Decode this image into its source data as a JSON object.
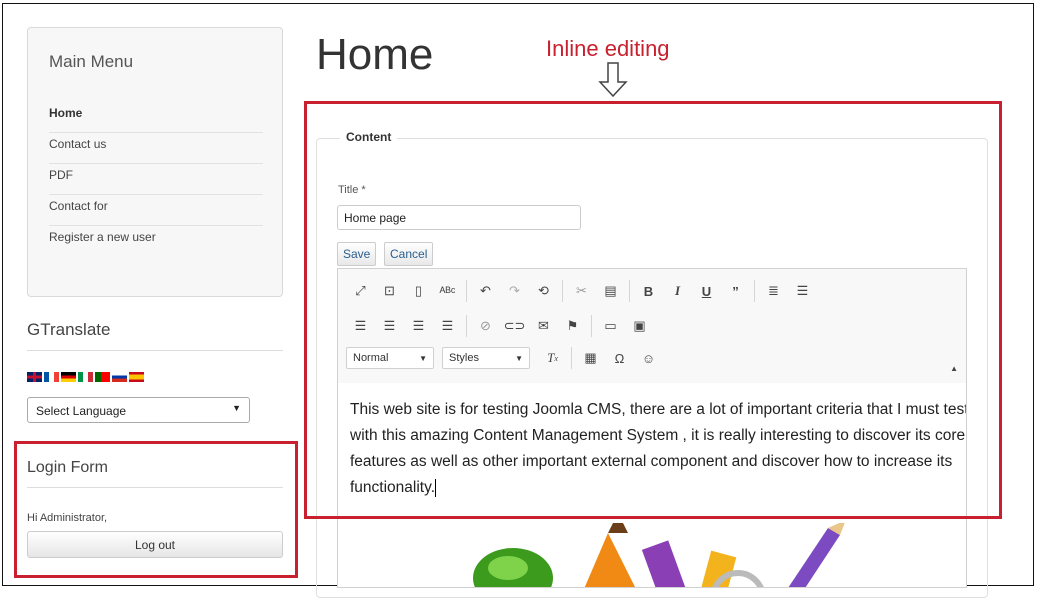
{
  "sidebar": {
    "main_menu": {
      "title": "Main Menu",
      "items": [
        {
          "label": "Home"
        },
        {
          "label": "Contact us"
        },
        {
          "label": "PDF"
        },
        {
          "label": "Contact for"
        },
        {
          "label": "Register a new user"
        }
      ]
    },
    "gtranslate": {
      "title": "GTranslate",
      "flags": [
        "uk-flag-icon",
        "fr-flag-icon",
        "de-flag-icon",
        "it-flag-icon",
        "pt-flag-icon",
        "ru-flag-icon",
        "es-flag-icon"
      ],
      "select_value": "Select Language"
    },
    "login": {
      "title": "Login Form",
      "greeting": "Hi Administrator,",
      "logout_label": "Log out"
    }
  },
  "main": {
    "page_title": "Home",
    "annotation": "Inline editing",
    "fieldset_legend": "Content",
    "title_label": "Title *",
    "title_value": "Home page",
    "save_label": "Save",
    "cancel_label": "Cancel",
    "format_combo": "Normal",
    "styles_combo": "Styles",
    "body_text": "This web site is for testing Joomla CMS, there are a lot of important criteria that I must test with this amazing Content Management System , it is really interesting to discover its core features as well as other important external component and discover how to increase its functionality."
  },
  "colors": {
    "annotation_red": "#c9202f",
    "link_blue": "#2a5e8e"
  }
}
